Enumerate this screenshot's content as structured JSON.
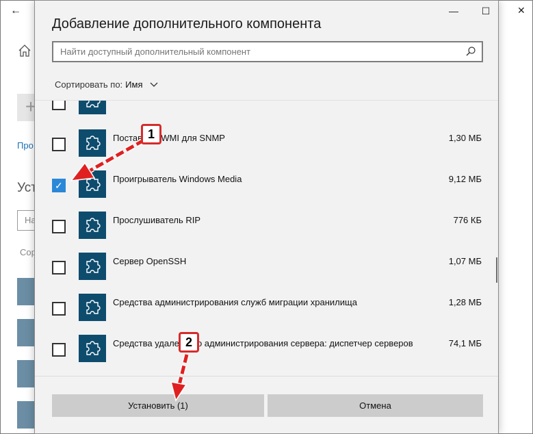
{
  "background_window": {
    "link_text": "Про",
    "heading": "Уст",
    "input_placeholder": "На",
    "sort_text": "Сор"
  },
  "dialog": {
    "title": "Добавление дополнительного компонента",
    "search": {
      "placeholder": "Найти доступный дополнительный компонент",
      "icon": "search-icon"
    },
    "sort": {
      "label": "Сортировать по:",
      "value": "Имя"
    },
    "items": [
      {
        "name": "",
        "size": "",
        "checked": false
      },
      {
        "name": "Поставщик WMI для SNMP",
        "size": "1,30 МБ",
        "checked": false
      },
      {
        "name": "Проигрыватель Windows Media",
        "size": "9,12 МБ",
        "checked": true
      },
      {
        "name": "Прослушиватель RIP",
        "size": "776 КБ",
        "checked": false
      },
      {
        "name": "Сервер OpenSSH",
        "size": "1,07 МБ",
        "checked": false
      },
      {
        "name": "Средства администрирования служб миграции хранилища",
        "size": "1,28 МБ",
        "checked": false
      },
      {
        "name": "Средства удаленного администрирования сервера: диспетчер серверов",
        "size": "74,1 МБ",
        "checked": false
      }
    ],
    "buttons": {
      "install": "Установить (1)",
      "cancel": "Отмена"
    }
  },
  "annotations": {
    "badge1": "1",
    "badge2": "2"
  },
  "colors": {
    "accent": "#2b88d8",
    "tile": "#0e4c6e",
    "annotation": "#d62b2b"
  }
}
